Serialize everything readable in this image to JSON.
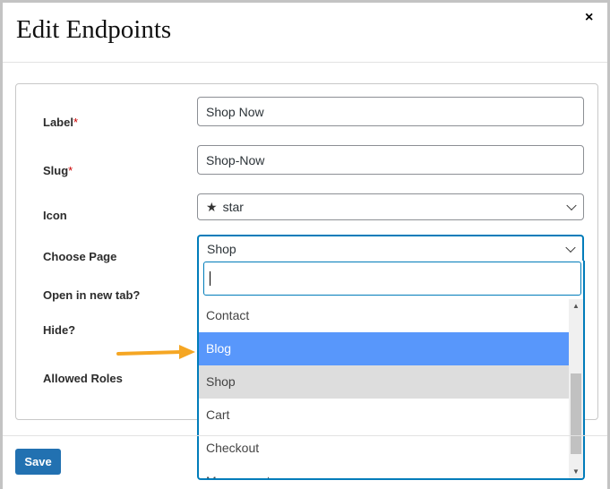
{
  "dialog": {
    "title": "Edit Endpoints",
    "close": "×"
  },
  "fields": {
    "label": {
      "label": "Label",
      "required": "*",
      "value": "Shop Now"
    },
    "slug": {
      "label": "Slug",
      "required": "*",
      "value": "Shop-Now"
    },
    "icon": {
      "label": "Icon",
      "value": "star",
      "glyph": "★"
    },
    "page": {
      "label": "Choose Page",
      "value": "Shop"
    },
    "new_tab": {
      "label": "Open in new tab?"
    },
    "hide": {
      "label": "Hide?"
    },
    "roles": {
      "label": "Allowed Roles"
    }
  },
  "dropdown": {
    "search_value": "",
    "options": [
      "Contact",
      "Blog",
      "Shop",
      "Cart",
      "Checkout",
      "My account"
    ],
    "highlighted": "Blog",
    "selected": "Shop"
  },
  "footer": {
    "save": "Save"
  },
  "colors": {
    "accent": "#2271b1",
    "highlight": "#5897fb",
    "arrow": "#f5a623"
  }
}
